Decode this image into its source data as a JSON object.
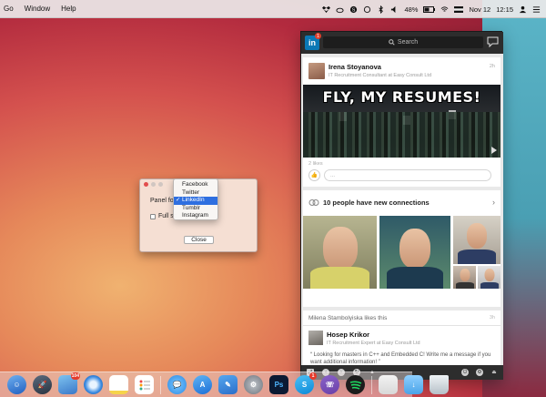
{
  "menubar": {
    "items": [
      "Go",
      "Window",
      "Help"
    ],
    "battery": "48%",
    "date": "Nov 12",
    "time": "12:15"
  },
  "dialog": {
    "panel_label": "Panel for",
    "fullscreen_label": "Full sc",
    "close_button": "Close",
    "dropdown_options": [
      "Facebook",
      "Twitter",
      "LinkedIn",
      "Tumblr",
      "Instagram"
    ],
    "selected_option": "LinkedIn"
  },
  "linkedin": {
    "logo": "in",
    "badge_count": "1",
    "search_placeholder": "Search",
    "post1": {
      "name": "Irena Stoyanova",
      "subtitle": "IT Recruitment Consultant at Easy Consult Ltd",
      "time": "2h",
      "image_caption": "FLY, MY RESUMES!",
      "likes": "2 likes",
      "comment_placeholder": "..."
    },
    "connections": {
      "title": "10 people have new connections"
    },
    "post2": {
      "liked_line": "Milena Stambolyiska likes this",
      "time": "3h",
      "name": "Hosep Krikor",
      "subtitle": "IT Recruitment Expert at Easy Consult Ltd",
      "text": "Looking for masters in C++ and Embedded C! Write me a message if you want additional information!"
    }
  },
  "dock": {
    "badges": {
      "photos": "104",
      "skype": "1"
    },
    "ps_label": "Ps"
  },
  "colors": {
    "linkedin_blue": "#0b78b5",
    "selection_blue": "#2e6fe0",
    "badge_red": "#e53b2b"
  }
}
